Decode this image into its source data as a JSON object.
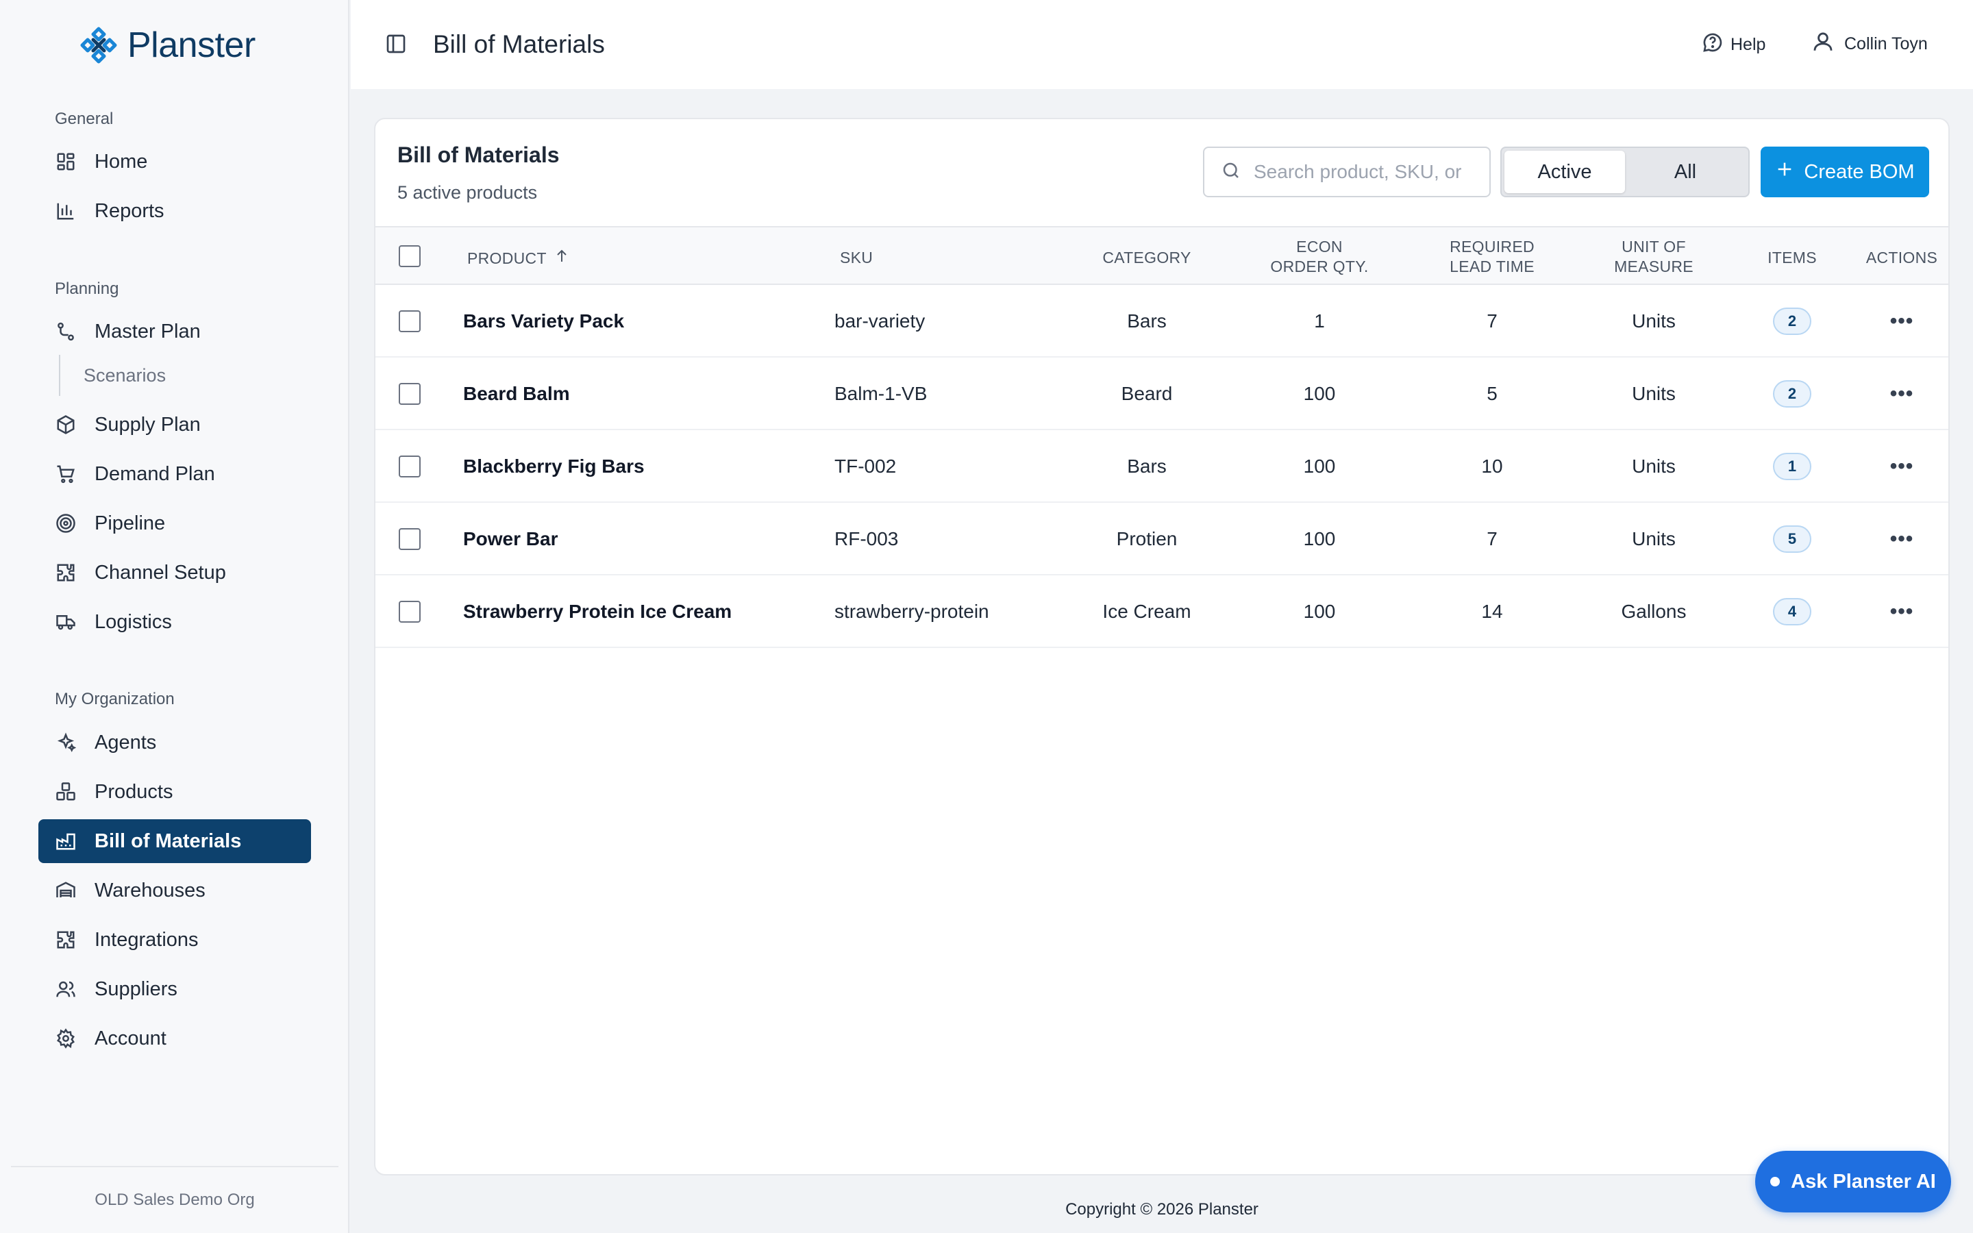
{
  "app": {
    "name": "Planster",
    "brand_color": "#0d416d",
    "accent_color": "#0c91e0"
  },
  "sidebar": {
    "sections": [
      {
        "label": "General"
      },
      {
        "label": "Planning"
      },
      {
        "label": "My Organization"
      }
    ],
    "items": [
      {
        "label": "Home",
        "icon": "dashboard-icon"
      },
      {
        "label": "Reports",
        "icon": "bar-chart-icon"
      },
      {
        "label": "Master Plan",
        "icon": "route-icon"
      },
      {
        "label": "Scenarios",
        "icon": ""
      },
      {
        "label": "Supply Plan",
        "icon": "package-icon"
      },
      {
        "label": "Demand Plan",
        "icon": "shopping-cart-icon"
      },
      {
        "label": "Pipeline",
        "icon": "target-icon"
      },
      {
        "label": "Channel Setup",
        "icon": "puzzle-icon"
      },
      {
        "label": "Logistics",
        "icon": "truck-icon"
      },
      {
        "label": "Agents",
        "icon": "sparkles-icon"
      },
      {
        "label": "Products",
        "icon": "boxes-icon"
      },
      {
        "label": "Bill of Materials",
        "icon": "factory-icon",
        "active": true
      },
      {
        "label": "Warehouses",
        "icon": "warehouse-icon"
      },
      {
        "label": "Integrations",
        "icon": "puzzle-icon"
      },
      {
        "label": "Suppliers",
        "icon": "users-icon"
      },
      {
        "label": "Account",
        "icon": "gear-icon"
      }
    ],
    "org_name": "OLD Sales Demo Org"
  },
  "header": {
    "title": "Bill of Materials",
    "help_label": "Help",
    "user_name": "Collin Toyn"
  },
  "card": {
    "title": "Bill of Materials",
    "subtitle": "5 active products",
    "search_placeholder": "Search product, SKU, or",
    "filter_active_label": "Active",
    "filter_all_label": "All",
    "filter_selected": "Active",
    "create_label": "Create BOM"
  },
  "table": {
    "columns": {
      "product": "PRODUCT",
      "sku": "SKU",
      "category": "CATEGORY",
      "econ_line1": "ECON",
      "econ_line2": "ORDER QTY.",
      "lead_line1": "REQUIRED",
      "lead_line2": "LEAD TIME",
      "uom_line1": "UNIT OF",
      "uom_line2": "MEASURE",
      "items": "ITEMS",
      "actions": "ACTIONS"
    },
    "sort": {
      "column": "product",
      "direction": "ascending"
    },
    "rows": [
      {
        "product": "Bars Variety Pack",
        "sku": "bar-variety",
        "category": "Bars",
        "eoq": "1",
        "lead_time": "7",
        "uom": "Units",
        "items": "2"
      },
      {
        "product": "Beard Balm",
        "sku": "Balm-1-VB",
        "category": "Beard",
        "eoq": "100",
        "lead_time": "5",
        "uom": "Units",
        "items": "2"
      },
      {
        "product": "Blackberry Fig Bars",
        "sku": "TF-002",
        "category": "Bars",
        "eoq": "100",
        "lead_time": "10",
        "uom": "Units",
        "items": "1"
      },
      {
        "product": "Power Bar",
        "sku": "RF-003",
        "category": "Protien",
        "eoq": "100",
        "lead_time": "7",
        "uom": "Units",
        "items": "5"
      },
      {
        "product": "Strawberry Protein Ice Cream",
        "sku": "strawberry-protein",
        "category": "Ice Cream",
        "eoq": "100",
        "lead_time": "14",
        "uom": "Gallons",
        "items": "4"
      }
    ],
    "row_action_icon": "more-horizontal-icon"
  },
  "footer": {
    "copyright": "Copyright © 2026 Planster"
  },
  "assistant": {
    "label": "Ask Planster AI"
  }
}
